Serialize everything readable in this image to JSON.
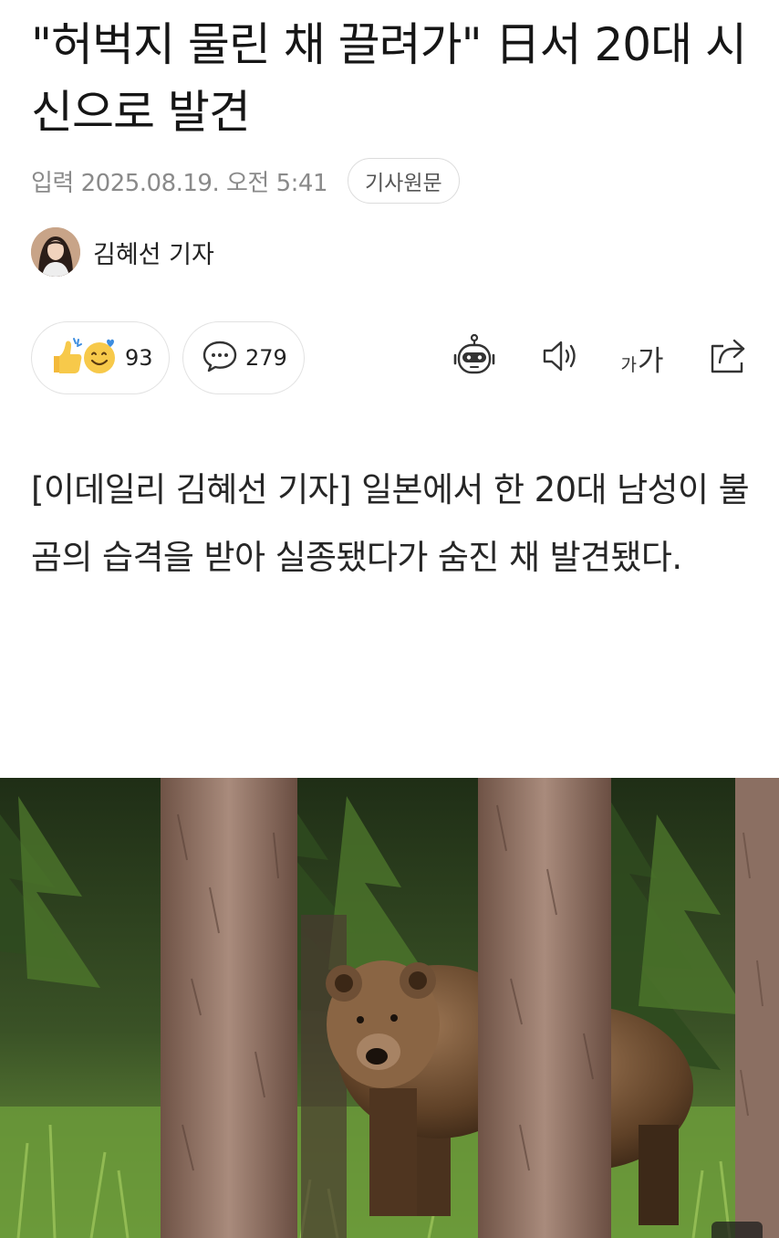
{
  "article": {
    "headline": "\"허벅지 물린 채 끌려가\" 日서 20대 시신으로 발견",
    "date": "입력 2025.08.19. 오전 5:41",
    "origin_label": "기사원문",
    "author": "김혜선 기자",
    "body": "[이데일리 김혜선 기자] 일본에서 한 20대 남성이 불곰의 습격을 받아 실종됐다가 숨진 채 발견됐다."
  },
  "actions": {
    "reaction_count": "93",
    "comment_count": "279",
    "font_small_label": "가",
    "font_large_label": "가"
  },
  "icons": {
    "reaction": "thumbs-up-and-smile-emoji-icon",
    "comment": "speech-bubble-icon",
    "summary_bot": "robot-icon",
    "tts": "speaker-icon",
    "font_size": "font-size-icon",
    "share": "share-icon"
  },
  "colors": {
    "text": "#1a1a1a",
    "meta": "#8a8a8a",
    "border": "#e2e2e2",
    "emoji_yellow": "#f7c94a"
  }
}
